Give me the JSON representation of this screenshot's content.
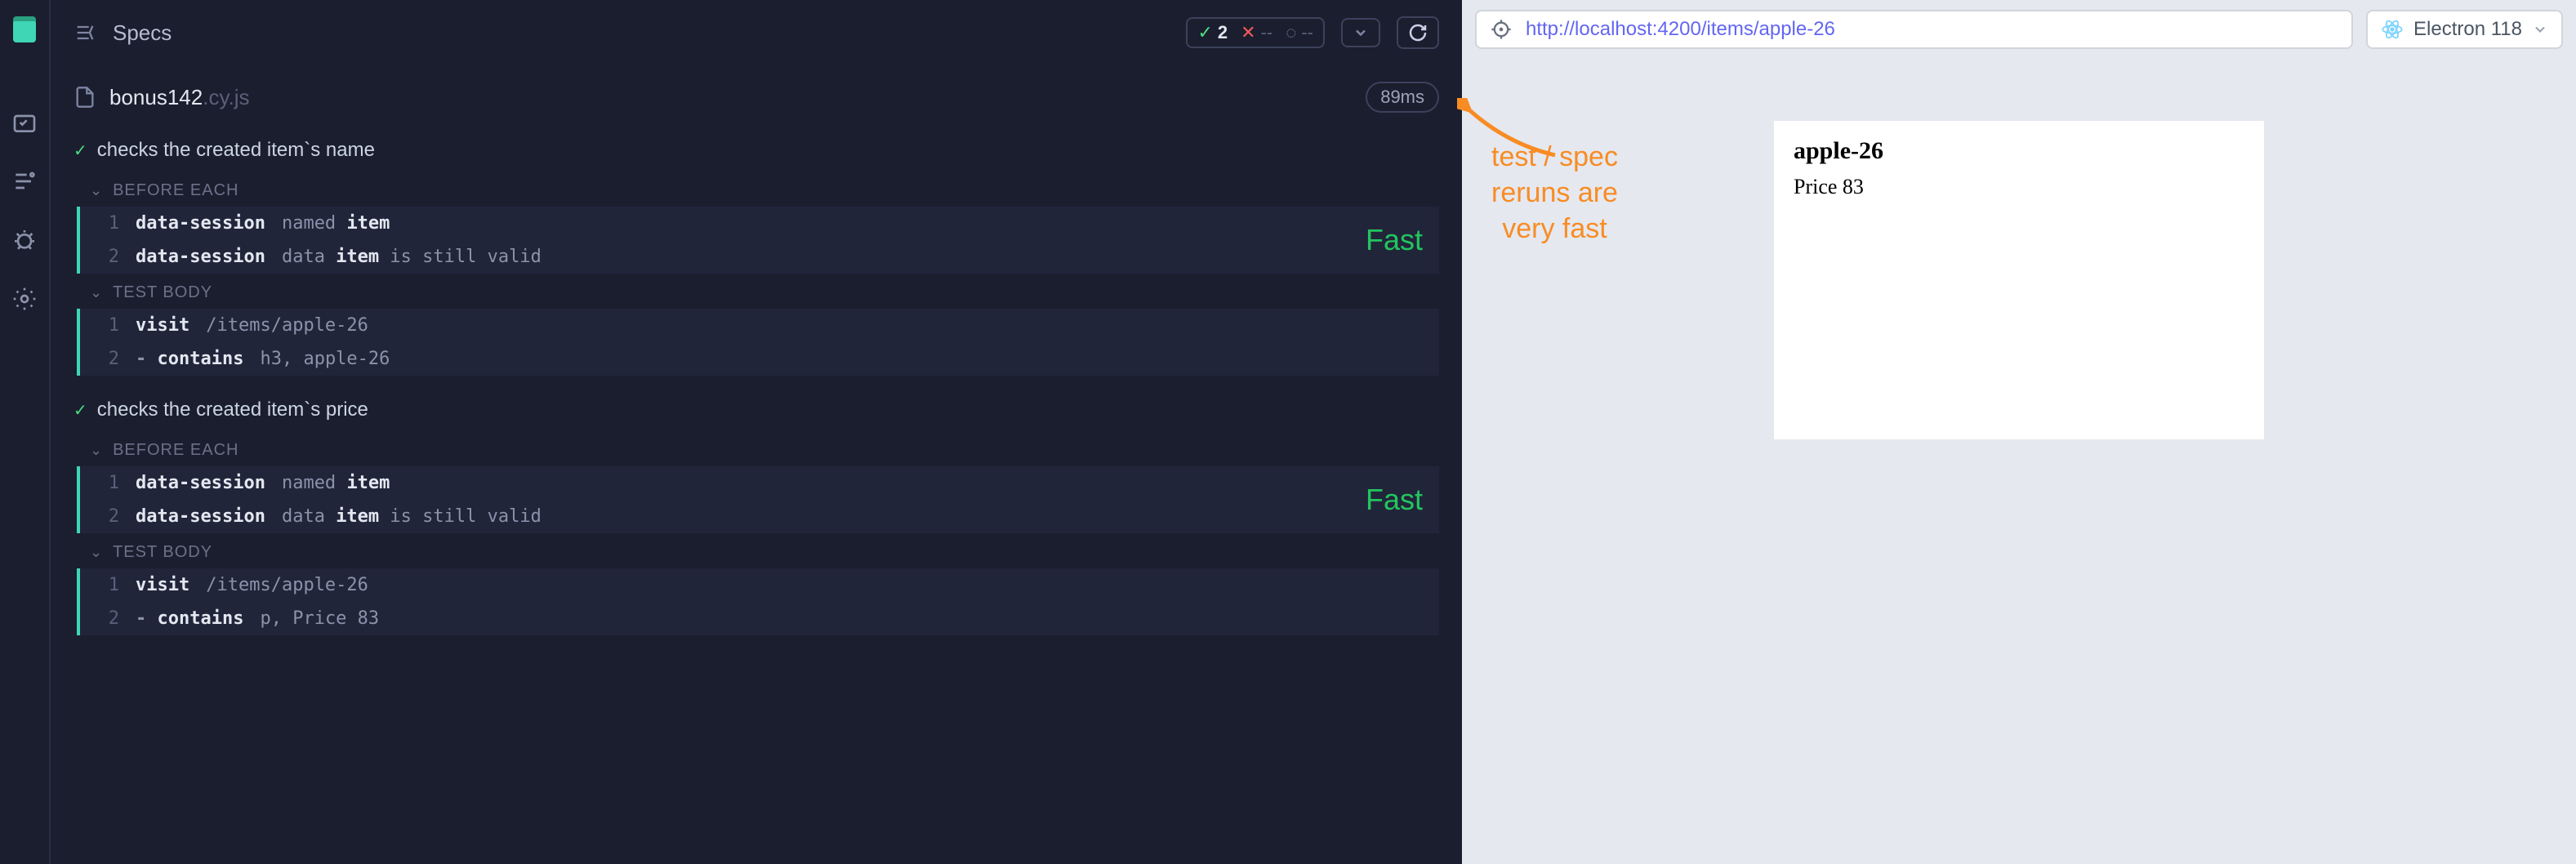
{
  "header": {
    "title": "Specs",
    "stats": {
      "pass": "2",
      "fail": "--",
      "pending": "--"
    }
  },
  "file": {
    "name": "bonus142",
    "ext": ".cy.js",
    "time": "89ms"
  },
  "tests": [
    {
      "title": "checks the created item`s name",
      "before": [
        {
          "num": "1",
          "cmd": "data-session",
          "arg_plain": "named",
          "arg_strong": "item"
        },
        {
          "num": "2",
          "cmd": "data-session",
          "arg_plain": "data",
          "arg_strong": "item",
          "arg_tail": "is still valid"
        }
      ],
      "body": [
        {
          "num": "1",
          "cmd": "visit",
          "arg": "/items/apple-26"
        },
        {
          "num": "2",
          "cmd": "-contains",
          "arg": "h3, apple-26"
        }
      ],
      "annotation": "Fast"
    },
    {
      "title": "checks the created item`s price",
      "before": [
        {
          "num": "1",
          "cmd": "data-session",
          "arg_plain": "named",
          "arg_strong": "item"
        },
        {
          "num": "2",
          "cmd": "data-session",
          "arg_plain": "data",
          "arg_strong": "item",
          "arg_tail": "is still valid"
        }
      ],
      "body": [
        {
          "num": "1",
          "cmd": "visit",
          "arg": "/items/apple-26"
        },
        {
          "num": "2",
          "cmd": "-contains",
          "arg": "p, Price 83"
        }
      ],
      "annotation": "Fast"
    }
  ],
  "labels": {
    "before_each": "BEFORE EACH",
    "test_body": "TEST BODY"
  },
  "preview": {
    "url": "http://localhost:4200/items/apple-26",
    "browser": "Electron 118",
    "page_title": "apple-26",
    "page_price": "Price 83"
  },
  "annotation_lines": [
    "test / spec",
    "reruns are",
    "very fast"
  ]
}
